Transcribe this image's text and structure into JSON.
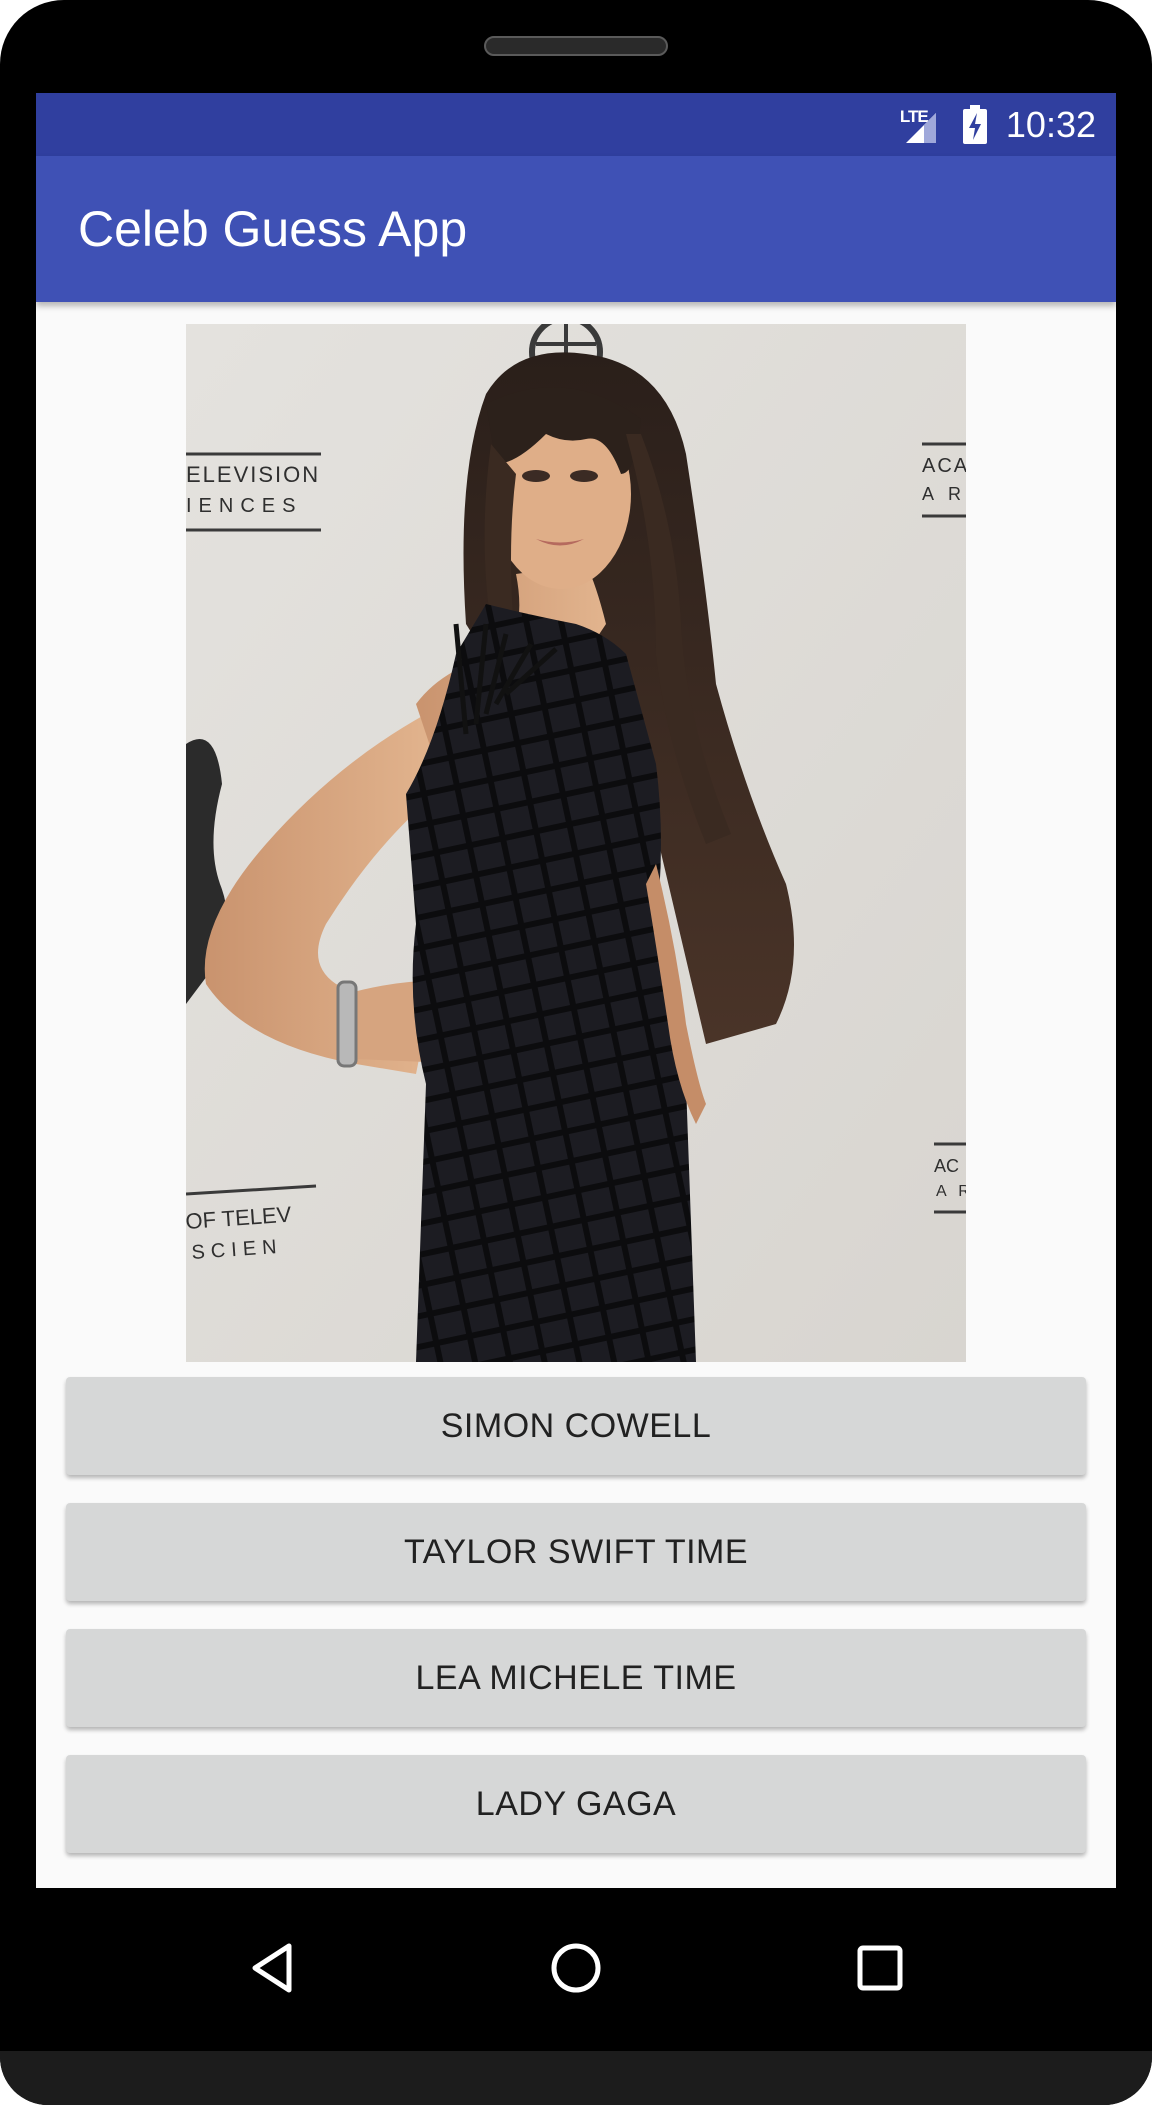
{
  "status_bar": {
    "network": "LTE",
    "time": "10:32"
  },
  "app_bar": {
    "title": "Celeb Guess App"
  },
  "celeb_image": {
    "backdrop_text_left_top": [
      "ELEVISION",
      "IENCES"
    ],
    "backdrop_text_right_top": [
      "ACA",
      "A R"
    ],
    "backdrop_text_left_bottom": [
      "OF TELEV",
      "SCIEN"
    ],
    "backdrop_text_right_bottom": [
      "AC",
      "A R"
    ]
  },
  "answers": [
    {
      "label": "SIMON COWELL"
    },
    {
      "label": "TAYLOR SWIFT TIME"
    },
    {
      "label": "LEA MICHELE TIME"
    },
    {
      "label": "LADY GAGA"
    }
  ],
  "nav": {
    "back": "back-icon",
    "home": "home-icon",
    "recents": "recents-icon"
  },
  "colors": {
    "status_bar": "#303f9f",
    "app_bar": "#3f51b5",
    "button": "#d6d7d7"
  }
}
